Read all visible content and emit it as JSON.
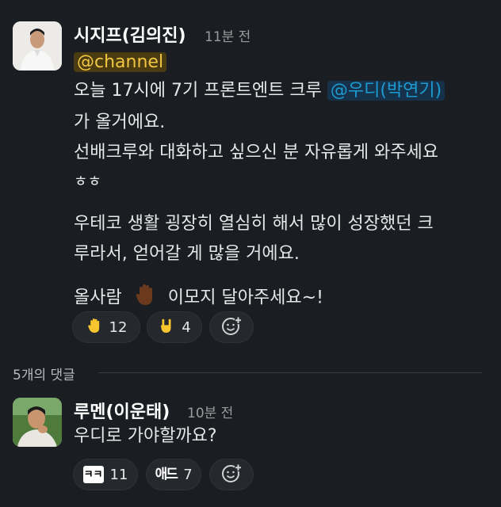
{
  "message": {
    "author": "시지프(김의진)",
    "time": "11분 전",
    "mention_channel": "@channel",
    "line1_prefix": "오늘 17시에 7기 프론트엔트 크루",
    "mention_user": "@우디(박연기)",
    "line2": "가 올거에요.",
    "line3": "선배크루와 대화하고 싶으신 분 자유롭게 와주세요",
    "line4": "ㅎㅎ",
    "line5": "우테코 생활 굉장히 열심히 해서 많이 성장했던 크",
    "line6": "루라서, 얻어갈 게 많을 거에요.",
    "line7_prefix": "올사람",
    "line7_suffix": "이모지 달아주세요~!",
    "reactions": [
      {
        "icon": "raised-hand-emoji",
        "count": "12"
      },
      {
        "icon": "rock-on-emoji",
        "count": "4"
      }
    ]
  },
  "thread": {
    "label": "5개의 댓글"
  },
  "reply": {
    "author": "루멘(이운태)",
    "time": "10분 전",
    "text": "우디로 가야할까요?",
    "reactions": [
      {
        "icon": "kk-emoji",
        "label": "ㅋㅋ",
        "count": "11"
      },
      {
        "icon": "ahae-emoji",
        "label": "애드",
        "count": "7"
      }
    ]
  },
  "colors": {
    "background": "#1a1d21",
    "channel_mention": "#f2c744",
    "user_mention": "#1d9bd1"
  }
}
